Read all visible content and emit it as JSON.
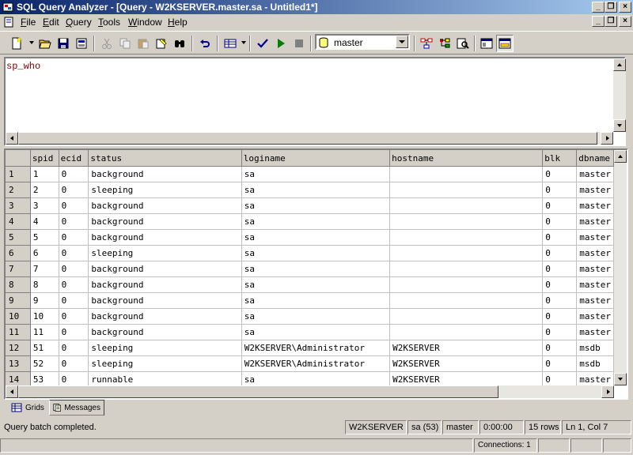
{
  "window": {
    "title": "SQL Query Analyzer - [Query - W2KSERVER.master.sa - Untitled1*]"
  },
  "menu": [
    {
      "label": "File",
      "u": "F",
      "rest": "ile"
    },
    {
      "label": "Edit",
      "u": "E",
      "rest": "dit"
    },
    {
      "label": "Query",
      "u": "Q",
      "rest": "uery"
    },
    {
      "label": "Tools",
      "u": "T",
      "rest": "ools"
    },
    {
      "label": "Window",
      "u": "W",
      "rest": "indow"
    },
    {
      "label": "Help",
      "u": "H",
      "rest": "elp"
    }
  ],
  "toolbar": {
    "database": "master",
    "icons": [
      "new-query-icon",
      "open-icon",
      "save-icon",
      "load-template-icon",
      "cut-icon",
      "copy-icon",
      "paste-icon",
      "clear-window-icon",
      "find-icon",
      "undo-icon",
      "results-mode-icon",
      "parse-query-icon",
      "execute-query-icon",
      "cancel-query-icon",
      "database-icon",
      "execution-plan-icon",
      "object-browser-icon",
      "object-search-icon",
      "current-connection-icon",
      "show-results-pane-icon"
    ]
  },
  "editor": {
    "text": "sp_who"
  },
  "grid": {
    "columns": [
      "spid",
      "ecid",
      "status",
      "loginame",
      "hostname",
      "blk",
      "dbname"
    ],
    "rows": [
      [
        "1",
        "1",
        "0",
        "background",
        "sa",
        "",
        "0",
        "master"
      ],
      [
        "2",
        "2",
        "0",
        "sleeping",
        "sa",
        "",
        "0",
        "master"
      ],
      [
        "3",
        "3",
        "0",
        "background",
        "sa",
        "",
        "0",
        "master"
      ],
      [
        "4",
        "4",
        "0",
        "background",
        "sa",
        "",
        "0",
        "master"
      ],
      [
        "5",
        "5",
        "0",
        "background",
        "sa",
        "",
        "0",
        "master"
      ],
      [
        "6",
        "6",
        "0",
        "sleeping",
        "sa",
        "",
        "0",
        "master"
      ],
      [
        "7",
        "7",
        "0",
        "background",
        "sa",
        "",
        "0",
        "master"
      ],
      [
        "8",
        "8",
        "0",
        "background",
        "sa",
        "",
        "0",
        "master"
      ],
      [
        "9",
        "9",
        "0",
        "background",
        "sa",
        "",
        "0",
        "master"
      ],
      [
        "10",
        "10",
        "0",
        "background",
        "sa",
        "",
        "0",
        "master"
      ],
      [
        "11",
        "11",
        "0",
        "background",
        "sa",
        "",
        "0",
        "master"
      ],
      [
        "12",
        "51",
        "0",
        "sleeping",
        "W2KSERVER\\Administrator",
        "W2KSERVER",
        "0",
        "msdb"
      ],
      [
        "13",
        "52",
        "0",
        "sleeping",
        "W2KSERVER\\Administrator",
        "W2KSERVER",
        "0",
        "msdb"
      ],
      [
        "14",
        "53",
        "0",
        "runnable",
        "sa",
        "W2KSERVER",
        "0",
        "master"
      ]
    ]
  },
  "tabs": [
    {
      "label": "Grids",
      "icon": "grid-icon",
      "active": false
    },
    {
      "label": "Messages",
      "icon": "messages-icon",
      "active": true
    }
  ],
  "status": {
    "message": "Query batch completed.",
    "server": "W2KSERVER",
    "user": "sa (53)",
    "database": "master",
    "elapsed": "0:00:00",
    "rows": "15 rows",
    "position": "Ln 1, Col 7",
    "connections": "Connections: 1"
  },
  "colors": {
    "title_start": "#0a246a",
    "title_end": "#a6caf0",
    "query_text": "#800000",
    "chrome": "#d4d0c8"
  }
}
